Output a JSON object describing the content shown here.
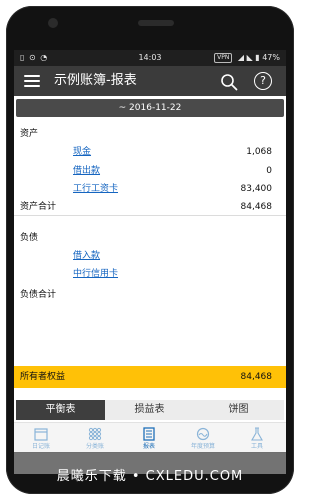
{
  "status_bar": {
    "left_icons": "▯ ⊙ ◔",
    "time": "14:03",
    "vpn": "VPN",
    "right_icons": "◢ ◣ ▮",
    "battery": "47%"
  },
  "app_bar": {
    "title": "示例账簿-报表"
  },
  "date_range": "~ 2016-11-22",
  "assets": {
    "header": "资产",
    "items": [
      {
        "name": "现金",
        "value": "1,068"
      },
      {
        "name": "借出款",
        "value": "0"
      },
      {
        "name": "工行工资卡",
        "value": "83,400"
      }
    ],
    "total_label": "资产合计",
    "total_value": "84,468"
  },
  "liabilities": {
    "header": "负债",
    "items": [
      {
        "name": "借入款",
        "value": ""
      },
      {
        "name": "中行信用卡",
        "value": ""
      }
    ],
    "total_label": "负债合计",
    "total_value": ""
  },
  "equity": {
    "label": "所有者权益",
    "value": "84,468"
  },
  "report_tabs": [
    "平衡表",
    "损益表",
    "饼图"
  ],
  "bottom_nav": [
    {
      "label": "日记账",
      "icon": "calendar-icon"
    },
    {
      "label": "分类账",
      "icon": "grid-icon"
    },
    {
      "label": "报表",
      "icon": "report-icon"
    },
    {
      "label": "年度预算",
      "icon": "budget-gauge-icon"
    },
    {
      "label": "工具",
      "icon": "flask-icon"
    }
  ],
  "watermark": "晨曦乐下载 • CXLEDU.COM",
  "colors": {
    "appbar": "#3b3b3b",
    "link": "#1565c0",
    "equity_highlight": "#ffc107",
    "nav_active": "#1e6fb8"
  }
}
